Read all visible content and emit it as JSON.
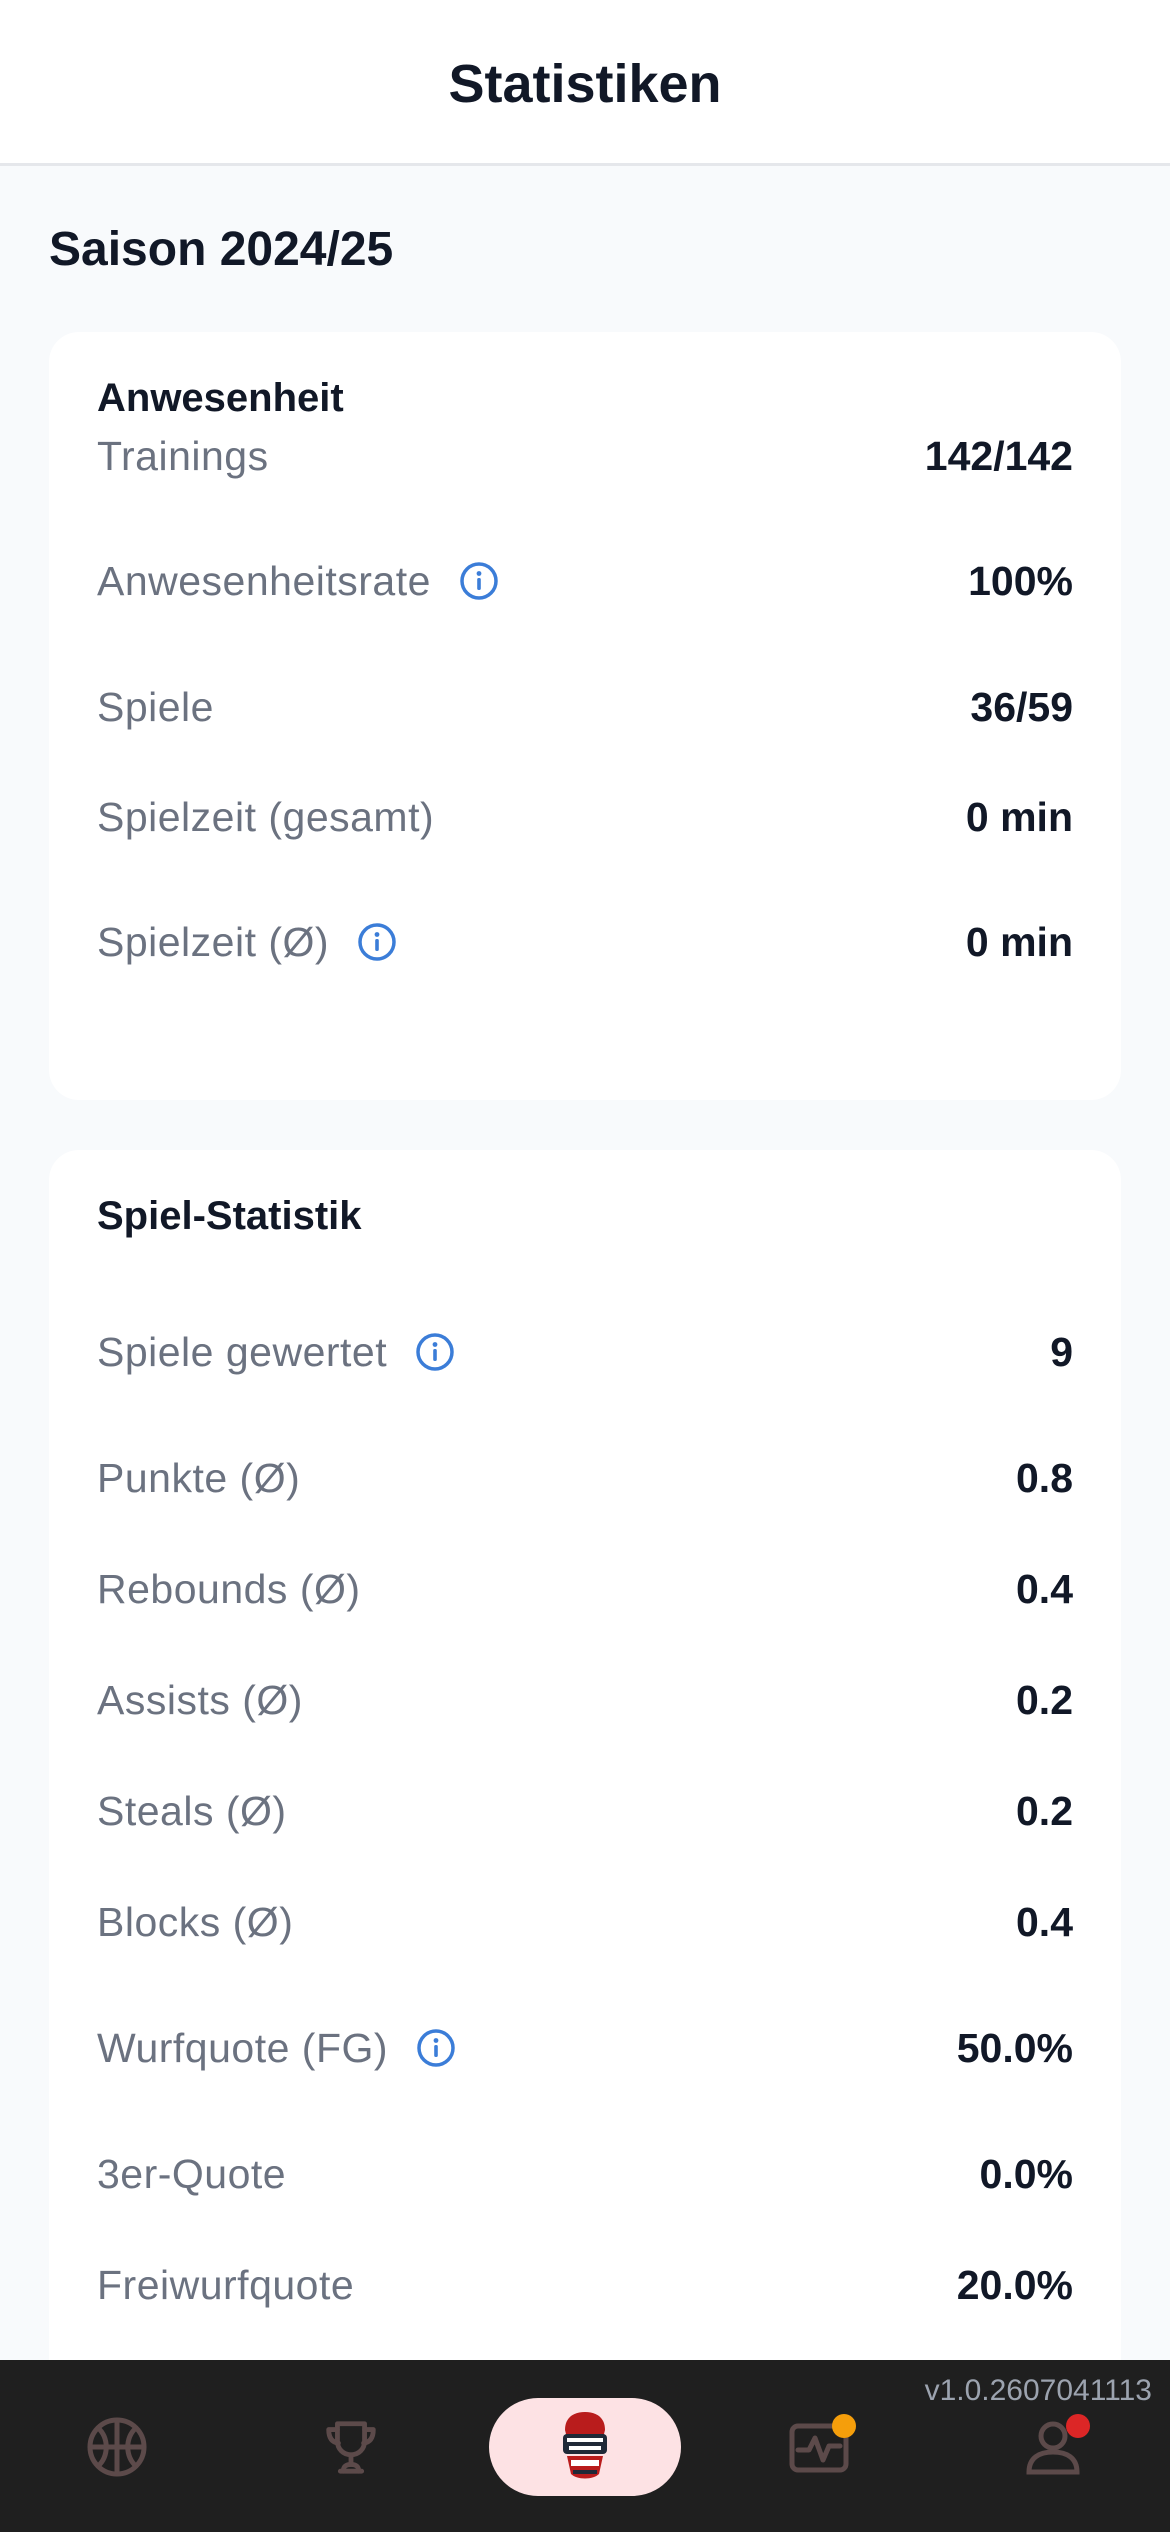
{
  "header": {
    "title": "Statistiken"
  },
  "season": {
    "title": "Saison 2024/25"
  },
  "attendance": {
    "title": "Anwesenheit",
    "rows": [
      {
        "label": "Trainings",
        "value": "142/142",
        "info": false
      },
      {
        "label": "Anwesenheitsrate",
        "value": "100%",
        "info": true
      },
      {
        "label": "Spiele",
        "value": "36/59",
        "info": false
      },
      {
        "label": "Spielzeit (gesamt)",
        "value": "0 min",
        "info": false
      },
      {
        "label": "Spielzeit (Ø)",
        "value": "0 min",
        "info": true
      }
    ]
  },
  "game_stats": {
    "title": "Spiel-Statistik",
    "rows": [
      {
        "label": "Spiele gewertet",
        "value": "9",
        "info": true
      },
      {
        "label": "Punkte (Ø)",
        "value": "0.8",
        "info": false
      },
      {
        "label": "Rebounds (Ø)",
        "value": "0.4",
        "info": false
      },
      {
        "label": "Assists (Ø)",
        "value": "0.2",
        "info": false
      },
      {
        "label": "Steals (Ø)",
        "value": "0.2",
        "info": false
      },
      {
        "label": "Blocks (Ø)",
        "value": "0.4",
        "info": false
      },
      {
        "label": "Wurfquote (FG)",
        "value": "50.0%",
        "info": true
      },
      {
        "label": "3er-Quote",
        "value": "0.0%",
        "info": false
      },
      {
        "label": "Freiwurfquote",
        "value": "20.0%",
        "info": false
      }
    ]
  },
  "bottom_nav": {
    "version": "v1.0.2607041113",
    "items": [
      {
        "icon": "basketball-icon"
      },
      {
        "icon": "trophy-icon"
      },
      {
        "icon": "team-logo-icon",
        "active": true
      },
      {
        "icon": "activity-chart-icon",
        "badge_color": "#f59e0b"
      },
      {
        "icon": "profile-icon",
        "badge_color": "#dc2626"
      }
    ]
  },
  "colors": {
    "info_icon": "#3b7dd8",
    "nav_icon": "#5c4a4a",
    "nav_active_bg": "#fde2e4"
  }
}
